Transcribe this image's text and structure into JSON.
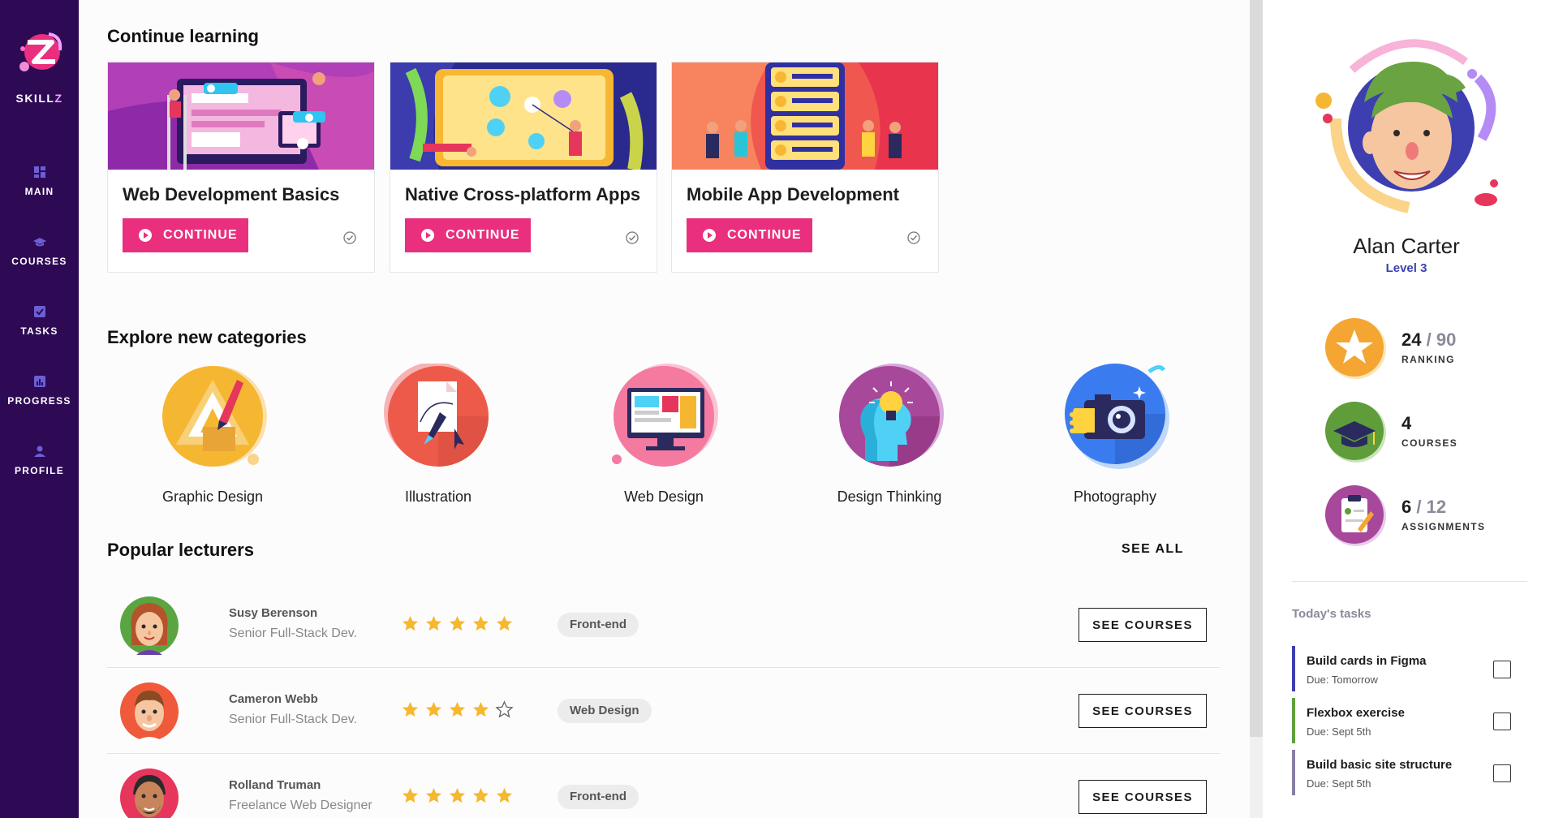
{
  "brand": {
    "name_prefix": "SKILL",
    "name_suffix": "Z"
  },
  "nav": [
    {
      "label": "MAIN",
      "icon": "dashboard-icon"
    },
    {
      "label": "COURSES",
      "icon": "graduation-cap-icon"
    },
    {
      "label": "TASKS",
      "icon": "checkbox-icon"
    },
    {
      "label": "PROGRESS",
      "icon": "bar-chart-icon"
    },
    {
      "label": "PROFILE",
      "icon": "person-icon"
    }
  ],
  "continue_learning": {
    "title": "Continue learning",
    "cards": [
      {
        "title": "Web Development Basics",
        "button": "CONTINUE"
      },
      {
        "title": "Native Cross-platform Apps",
        "button": "CONTINUE"
      },
      {
        "title": "Mobile App Development",
        "button": "CONTINUE"
      }
    ]
  },
  "explore": {
    "title": "Explore new categories",
    "categories": [
      {
        "label": "Graphic Design",
        "icon": "pen-tool-icon"
      },
      {
        "label": "Illustration",
        "icon": "vector-pen-icon"
      },
      {
        "label": "Web Design",
        "icon": "monitor-icon"
      },
      {
        "label": "Design Thinking",
        "icon": "lightbulb-head-icon"
      },
      {
        "label": "Photography",
        "icon": "camera-icon"
      }
    ]
  },
  "lecturers": {
    "title": "Popular lecturers",
    "see_all": "SEE ALL",
    "items": [
      {
        "name": "Susy Berenson",
        "role": "Senior Full-Stack Dev.",
        "rating": 5,
        "tag": "Front-end",
        "button": "SEE COURSES"
      },
      {
        "name": "Cameron Webb",
        "role": "Senior Full-Stack Dev.",
        "rating": 4,
        "tag": "Web Design",
        "button": "SEE COURSES"
      },
      {
        "name": "Rolland Truman",
        "role": "Freelance Web Designer",
        "rating": 5,
        "tag": "Front-end",
        "button": "SEE COURSES"
      }
    ]
  },
  "profile": {
    "name": "Alan Carter",
    "level": "Level 3",
    "stats": [
      {
        "value": "24",
        "total": "90",
        "label": "RANKING",
        "icon": "star-badge-icon"
      },
      {
        "value": "4",
        "total": "",
        "label": "COURSES",
        "icon": "graduation-cap-badge-icon"
      },
      {
        "value": "6",
        "total": "12",
        "label": "ASSIGNMENTS",
        "icon": "clipboard-badge-icon"
      }
    ]
  },
  "tasks": {
    "title": "Today's tasks",
    "items": [
      {
        "name": "Build cards in Figma",
        "due": "Due: Tomorrow",
        "color": "#3d3fb0"
      },
      {
        "name": "Flexbox exercise",
        "due": "Due: Sept 5th",
        "color": "#5fa03a"
      },
      {
        "name": "Build basic site structure",
        "due": "Due: Sept 5th",
        "color": "#8a7fa8"
      }
    ]
  },
  "colors": {
    "sidebar": "#2e0a55",
    "accent": "#ea2f7e",
    "level": "#3d3fb0",
    "star": "#f5b82e"
  }
}
